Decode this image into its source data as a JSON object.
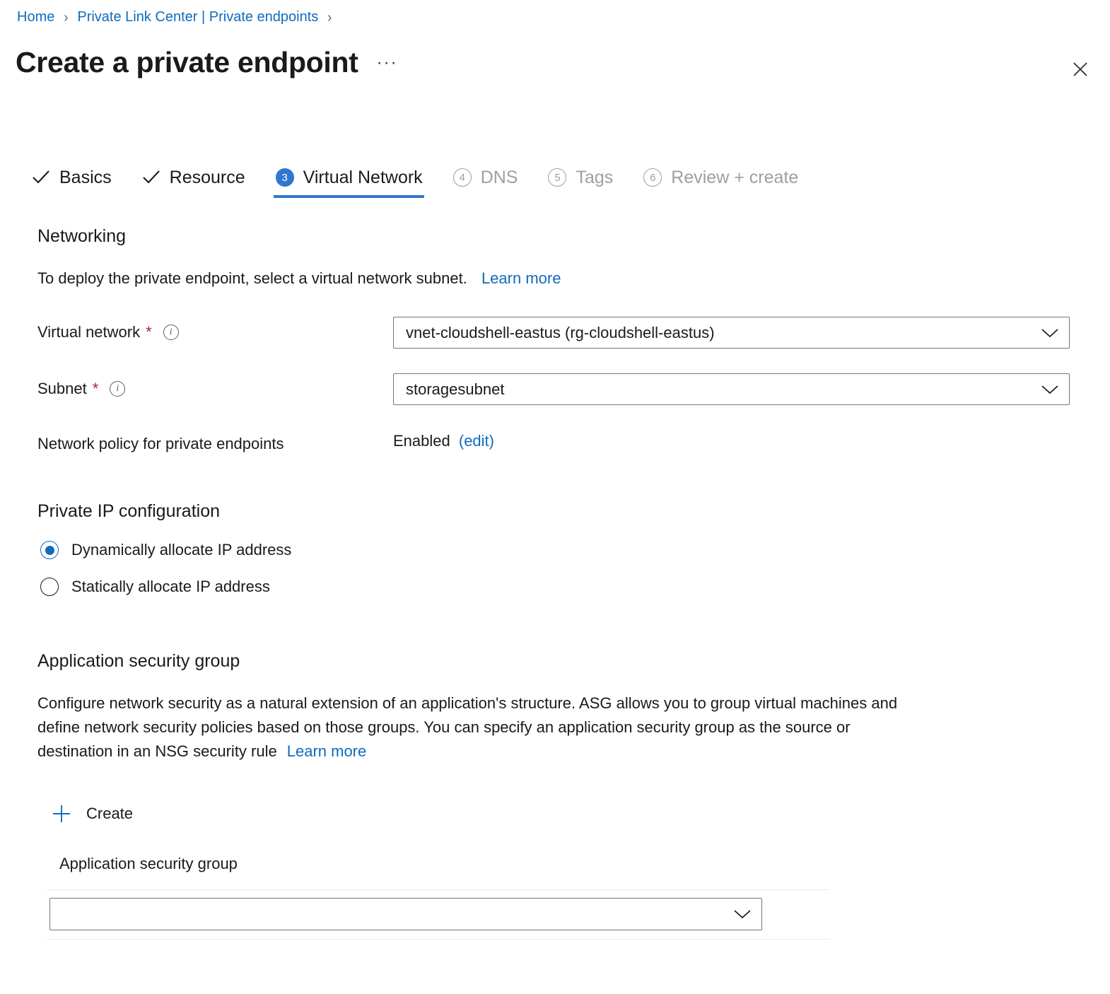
{
  "breadcrumb": {
    "items": [
      {
        "label": "Home"
      },
      {
        "label": "Private Link Center | Private endpoints"
      }
    ],
    "separator": "›"
  },
  "header": {
    "title": "Create a private endpoint",
    "more_label": "···",
    "close_icon": "close-icon"
  },
  "wizard": {
    "tabs": [
      {
        "label": "Basics",
        "state": "complete",
        "marker": "✓"
      },
      {
        "label": "Resource",
        "state": "complete",
        "marker": "✓"
      },
      {
        "label": "Virtual Network",
        "state": "active",
        "marker": "3"
      },
      {
        "label": "DNS",
        "state": "upcoming",
        "marker": "4"
      },
      {
        "label": "Tags",
        "state": "upcoming",
        "marker": "5"
      },
      {
        "label": "Review + create",
        "state": "upcoming",
        "marker": "6"
      }
    ]
  },
  "networking": {
    "heading": "Networking",
    "description": "To deploy the private endpoint, select a virtual network subnet.",
    "learn_more": "Learn more",
    "virtual_network": {
      "label": "Virtual network",
      "required_marker": "*",
      "value": "vnet-cloudshell-eastus (rg-cloudshell-eastus)"
    },
    "subnet": {
      "label": "Subnet",
      "required_marker": "*",
      "value": "storagesubnet"
    },
    "network_policy": {
      "label": "Network policy for private endpoints",
      "value": "Enabled",
      "edit_link": "(edit)"
    }
  },
  "private_ip": {
    "heading": "Private IP configuration",
    "options": [
      {
        "label": "Dynamically allocate IP address",
        "selected": true
      },
      {
        "label": "Statically allocate IP address",
        "selected": false
      }
    ]
  },
  "asg": {
    "heading": "Application security group",
    "description_line1": "Configure network security as a natural extension of an application's structure. ASG allows you to group virtual machines and",
    "description_line2": "define network security policies based on those groups. You can specify an application security group as the source or",
    "description_line3": "destination in an NSG security rule",
    "learn_more": "Learn more",
    "create_label": "Create",
    "grid_header": "Application security group",
    "selector_value": ""
  },
  "colors": {
    "accent": "#0f6cbd",
    "tab_active": "#3076cf",
    "required": "#a4262c",
    "text": "#1b1a19",
    "muted": "#a19f9d",
    "border": "#767676",
    "divider": "#edebe9"
  }
}
